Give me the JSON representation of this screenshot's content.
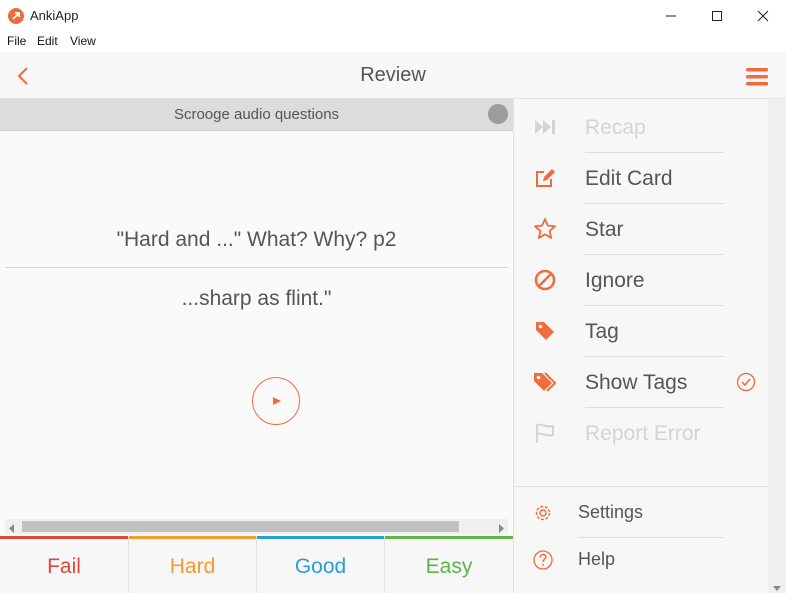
{
  "window": {
    "title": "AnkiApp"
  },
  "menubar": {
    "items": [
      "File",
      "Edit",
      "View"
    ]
  },
  "header": {
    "title": "Review"
  },
  "card": {
    "deck_name": "Scrooge audio questions",
    "question": "\"Hard and ...\" What? Why? p2",
    "answer": "...sharp as flint.\""
  },
  "answer_buttons": [
    {
      "label": "Fail",
      "color": "#e0463c"
    },
    {
      "label": "Hard",
      "color": "#f49a30"
    },
    {
      "label": "Good",
      "color": "#2a9fd6"
    },
    {
      "label": "Easy",
      "color": "#5cb545"
    }
  ],
  "side_menu": {
    "items": [
      {
        "label": "Recap",
        "icon": "fast-forward-icon",
        "enabled": false
      },
      {
        "label": "Edit Card",
        "icon": "edit-icon",
        "enabled": true
      },
      {
        "label": "Star",
        "icon": "star-icon",
        "enabled": true
      },
      {
        "label": "Ignore",
        "icon": "ban-icon",
        "enabled": true
      },
      {
        "label": "Tag",
        "icon": "tag-icon",
        "enabled": true
      },
      {
        "label": "Show Tags",
        "icon": "tags-icon",
        "enabled": true,
        "checked": true
      },
      {
        "label": "Report Error",
        "icon": "flag-icon",
        "enabled": false
      }
    ],
    "bottom": [
      {
        "label": "Settings",
        "icon": "gear-icon"
      },
      {
        "label": "Help",
        "icon": "help-icon"
      }
    ]
  },
  "colors": {
    "accent": "#f26b3a",
    "disabled": "#d4d4d4",
    "text": "#555555"
  }
}
